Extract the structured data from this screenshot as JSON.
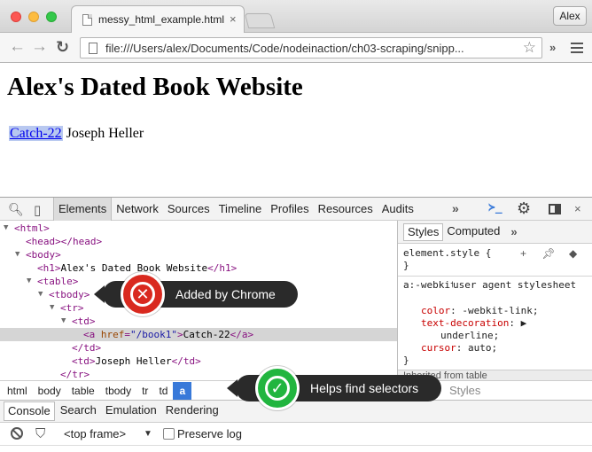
{
  "browser": {
    "tab_title": "messy_html_example.html",
    "tab_close": "×",
    "profile_name": "Alex",
    "url": "file:///Users/alex/Documents/Code/nodeinaction/ch03-scraping/snipp...",
    "extensions_chevron": "»"
  },
  "page": {
    "heading": "Alex's Dated Book Website",
    "book_link": "Catch-22",
    "author": "Joseph Heller"
  },
  "devtools": {
    "tabs": [
      "Elements",
      "Network",
      "Sources",
      "Timeline",
      "Profiles",
      "Resources",
      "Audits"
    ],
    "active_tab": "Elements",
    "more": "»",
    "console_icon": "≻_",
    "close": "×",
    "dom": [
      {
        "indent": 0,
        "tri": "▼",
        "open": "<html>"
      },
      {
        "indent": 1,
        "tri": "",
        "open": "<head></head>"
      },
      {
        "indent": 1,
        "tri": "▼",
        "open": "<body>"
      },
      {
        "indent": 2,
        "tri": "",
        "open": "<h1>",
        "text": "Alex's Dated Book Website",
        "close": "</h1>"
      },
      {
        "indent": 2,
        "tri": "▼",
        "open": "<table>"
      },
      {
        "indent": 3,
        "tri": "▼",
        "open": "<tbody>"
      },
      {
        "indent": 4,
        "tri": "▼",
        "open": "<tr>"
      },
      {
        "indent": 5,
        "tri": "▼",
        "open": "<td>"
      },
      {
        "indent": 6,
        "tri": "",
        "open": "<a",
        "attr_name": "href",
        "attr_value": "\"/book1\"",
        "open_end": ">",
        "text": "Catch-22",
        "close": "</a>",
        "selected": true
      },
      {
        "indent": 5,
        "tri": "",
        "open": "</td>"
      },
      {
        "indent": 5,
        "tri": "",
        "open": "<td>",
        "text": "Joseph Heller",
        "close": "</td>"
      },
      {
        "indent": 4,
        "tri": "",
        "open": "</tr>"
      }
    ],
    "breadcrumbs": [
      "html",
      "body",
      "table",
      "tbody",
      "tr",
      "td",
      "a"
    ],
    "active_crumb": "a",
    "styles": {
      "tabs": [
        "Styles",
        "Computed"
      ],
      "active_tab": "Styles",
      "more": "»",
      "element_style": "element.style {",
      "close_brace": "}",
      "rule_selector": "a:-webkit-any-link {",
      "rule_origin": "user agent stylesheet",
      "props": [
        {
          "name": "color",
          "value": "-webkit-link;"
        },
        {
          "name": "text-decoration",
          "value": ""
        },
        {
          "name": "",
          "value": "underline;"
        },
        {
          "name": "cursor",
          "value": "auto;"
        }
      ],
      "inherited": "Inherited from table",
      "bottom_label": "Styles"
    },
    "drawer_tabs": [
      "Console",
      "Search",
      "Emulation",
      "Rendering"
    ],
    "active_drawer_tab": "Console",
    "frame_select": "<top frame>",
    "preserve_log": "Preserve log"
  },
  "annotations": {
    "red_label": "Added by Chrome",
    "green_label": "Helps find selectors",
    "red_color": "#d9291f",
    "green_color": "#21b53f"
  }
}
